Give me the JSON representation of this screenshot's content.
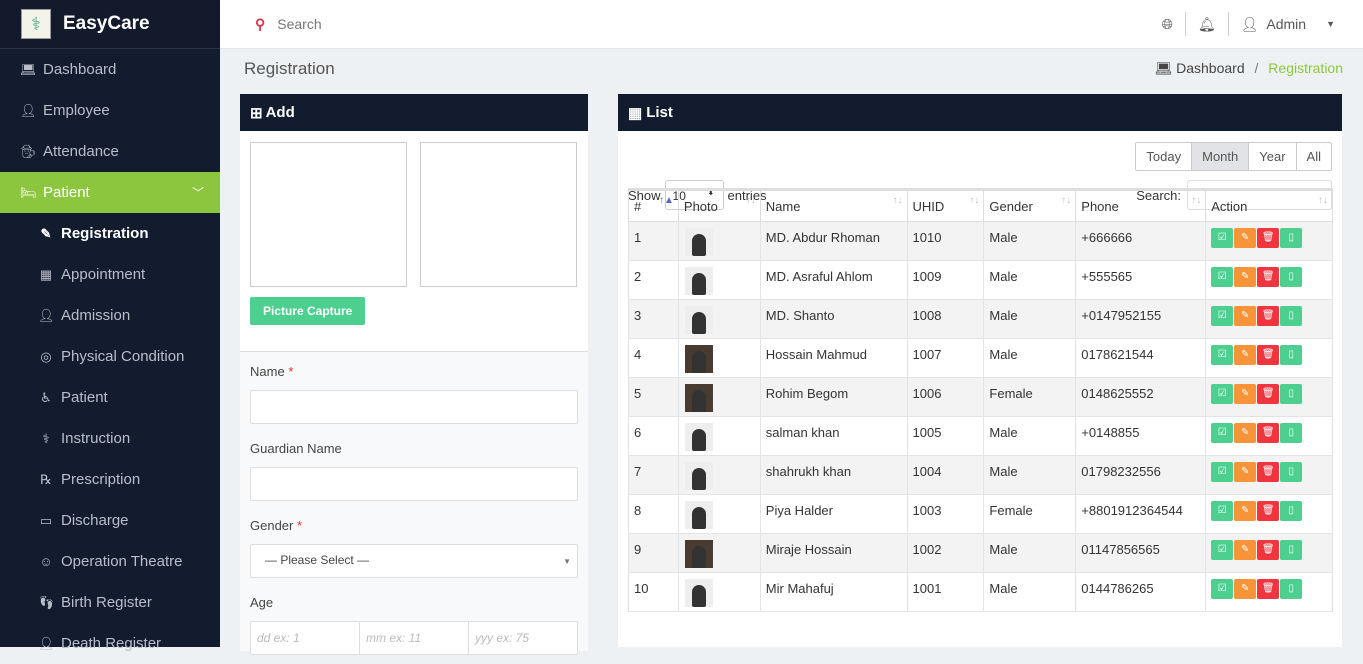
{
  "brand": {
    "name": "EasyCare"
  },
  "sidebar": {
    "items": [
      {
        "label": "Dashboard",
        "icon": "laptop-icon"
      },
      {
        "label": "Employee",
        "icon": "user-icon"
      },
      {
        "label": "Attendance",
        "icon": "user-secret-icon"
      },
      {
        "label": "Patient",
        "icon": "bed-icon"
      }
    ],
    "sub": [
      {
        "label": "Registration",
        "icon": "edit-icon"
      },
      {
        "label": "Appointment",
        "icon": "calendar-icon"
      },
      {
        "label": "Admission",
        "icon": "user-plus-icon"
      },
      {
        "label": "Physical Condition",
        "icon": "target-icon"
      },
      {
        "label": "Patient",
        "icon": "wheelchair-icon"
      },
      {
        "label": "Instruction",
        "icon": "stethoscope-icon"
      },
      {
        "label": "Prescription",
        "icon": "rx-icon"
      },
      {
        "label": "Discharge",
        "icon": "ticket-icon"
      },
      {
        "label": "Operation Theatre",
        "icon": "mask-icon"
      },
      {
        "label": "Birth Register",
        "icon": "footprint-icon"
      },
      {
        "label": "Death Register",
        "icon": "user-icon"
      }
    ]
  },
  "topbar": {
    "search_placeholder": "Search",
    "user": "Admin"
  },
  "page": {
    "title": "Registration",
    "breadcrumb": [
      "Dashboard",
      "/",
      "Registration"
    ]
  },
  "add": {
    "title": "Add",
    "capture": "Picture Capture",
    "name_label": "Name",
    "guardian_label": "Guardian Name",
    "gender_label": "Gender",
    "gender_value": "— Please Select —",
    "age_label": "Age",
    "age_ph": [
      "dd ex: 1",
      "mm ex: 11",
      "yyy ex: 75"
    ],
    "required": "*"
  },
  "list": {
    "title": "List",
    "filters": [
      "Today",
      "Month",
      "Year",
      "All"
    ],
    "active_filter": "Month",
    "show": "Show",
    "entries_value": "10",
    "entries": "entries",
    "search_label": "Search:",
    "columns": [
      "#",
      "Photo",
      "Name",
      "UHID",
      "Gender",
      "Phone",
      "Action"
    ],
    "rows": [
      [
        "1",
        "MD. Abdur Rhoman",
        "1010",
        "Male",
        "+666666"
      ],
      [
        "2",
        "MD. Asraful Ahlom",
        "1009",
        "Male",
        "+555565"
      ],
      [
        "3",
        "MD. Shanto",
        "1008",
        "Male",
        "+0147952155"
      ],
      [
        "4",
        "Hossain Mahmud",
        "1007",
        "Male",
        "0178621544"
      ],
      [
        "5",
        "Rohim Begom",
        "1006",
        "Female",
        "0148625552"
      ],
      [
        "6",
        "salman khan",
        "1005",
        "Male",
        "+0148855"
      ],
      [
        "7",
        "shahrukh khan",
        "1004",
        "Male",
        "01798232556"
      ],
      [
        "8",
        "Piya Halder",
        "1003",
        "Female",
        "+8801912364544"
      ],
      [
        "9",
        "Miraje Hossain",
        "1002",
        "Male",
        "01147856565"
      ],
      [
        "10",
        "Mir Mahafuj",
        "1001",
        "Male",
        "0144786265"
      ]
    ],
    "dark_photos": [
      3,
      4,
      8
    ]
  },
  "colors": {
    "sidebar": "#131c2e",
    "accent": "#8cc63f",
    "view": "#4ccf8f",
    "edit": "#f7943a",
    "delete": "#f0353e",
    "print": "#4ccf8f"
  }
}
